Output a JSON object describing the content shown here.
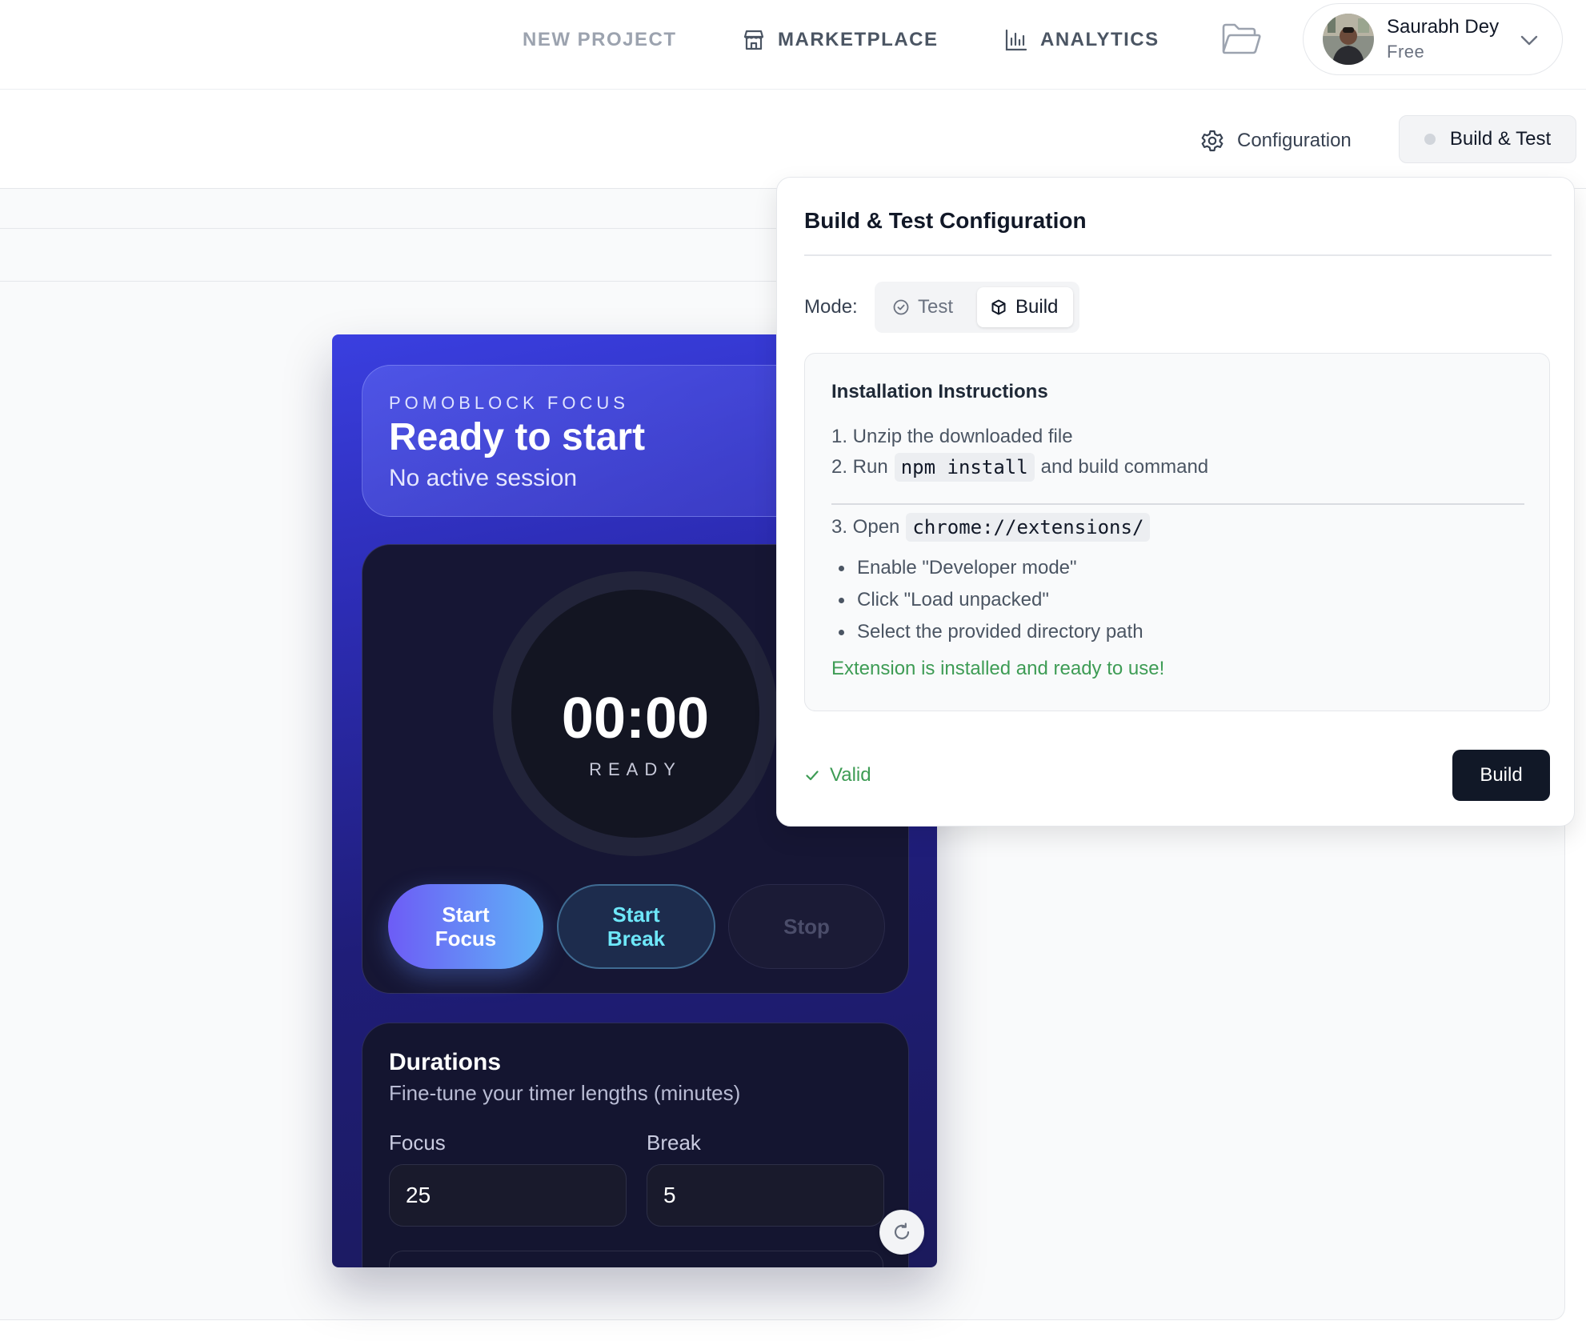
{
  "nav": {
    "new_project": "NEW PROJECT",
    "marketplace": "MARKETPLACE",
    "analytics": "ANALYTICS"
  },
  "user": {
    "name": "Saurabh Dey",
    "plan": "Free"
  },
  "toolbar": {
    "configuration": "Configuration",
    "build_test": "Build & Test"
  },
  "extension": {
    "kicker": "POMOBLOCK FOCUS",
    "title": "Ready to start",
    "subtitle": "No active session",
    "timer": "00:00",
    "status": "READY",
    "start_focus": "Start Focus",
    "start_break": "Start Break",
    "stop": "Stop",
    "durations_title": "Durations",
    "durations_sub": "Fine-tune your timer lengths (minutes)",
    "focus_label": "Focus",
    "break_label": "Break",
    "focus_value": "25",
    "break_value": "5"
  },
  "popover": {
    "title": "Build & Test Configuration",
    "mode_label": "Mode:",
    "mode_test": "Test",
    "mode_build": "Build",
    "mode_selected": "Build",
    "instructions_title": "Installation Instructions",
    "step1": "1. Unzip the downloaded file",
    "step2_pre": "2. Run",
    "step2_code": "npm install",
    "step2_post": "and build command",
    "step3_pre": "3. Open",
    "step3_code": "chrome://extensions/",
    "bullets": [
      "Enable \"Developer mode\"",
      "Click \"Load unpacked\"",
      "Select the provided directory path"
    ],
    "success": "Extension is installed and ready to use!",
    "valid": "Valid",
    "build_button": "Build"
  },
  "colors": {
    "accent_dark": "#111827",
    "success_green": "#3e9c55",
    "extension_bg": "#2d2db7"
  }
}
